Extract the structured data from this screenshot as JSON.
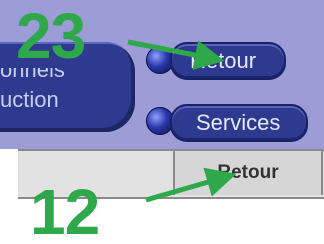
{
  "panel": {
    "block_line1": "onnels",
    "block_line2": "uction"
  },
  "buttons": {
    "retour_label": "Retour",
    "services_label": "Services"
  },
  "table": {
    "cell_label": "Retour"
  },
  "annotations": {
    "top_number": "23",
    "bottom_number": "12",
    "color": "#2ea84a"
  },
  "colors": {
    "panel_bg": "#9c9cd6",
    "button_bg": "#2e3a8f",
    "strip_bg": "#e2e2e2"
  }
}
